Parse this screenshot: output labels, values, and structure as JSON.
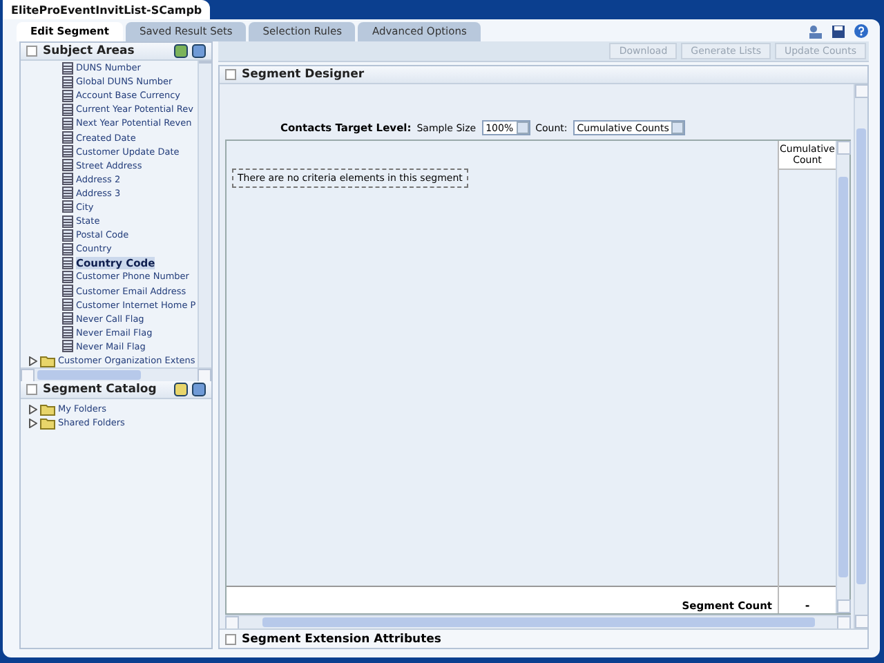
{
  "window": {
    "title": "EliteProEventInvitList-SCampb"
  },
  "tabs": [
    {
      "label": "Edit Segment",
      "selected": true
    },
    {
      "label": "Saved Result Sets",
      "selected": false
    },
    {
      "label": "Selection Rules",
      "selected": false
    },
    {
      "label": "Advanced Options",
      "selected": false
    }
  ],
  "subject_areas": {
    "title": "Subject Areas",
    "items": [
      {
        "label": "DUNS Number",
        "kind": "column",
        "selected": false
      },
      {
        "label": "Global DUNS Number",
        "kind": "column",
        "selected": false
      },
      {
        "label": "Account Base Currency",
        "kind": "column",
        "selected": false
      },
      {
        "label": "Current Year Potential Rev",
        "kind": "column",
        "selected": false
      },
      {
        "label": "Next Year Potential Reven",
        "kind": "column",
        "selected": false
      },
      {
        "label": "Created Date",
        "kind": "column",
        "selected": false
      },
      {
        "label": "Customer Update Date",
        "kind": "column",
        "selected": false
      },
      {
        "label": "Street Address",
        "kind": "column",
        "selected": false
      },
      {
        "label": "Address 2",
        "kind": "column",
        "selected": false
      },
      {
        "label": "Address 3",
        "kind": "column",
        "selected": false
      },
      {
        "label": "City",
        "kind": "column",
        "selected": false
      },
      {
        "label": "State",
        "kind": "column",
        "selected": false
      },
      {
        "label": "Postal Code",
        "kind": "column",
        "selected": false
      },
      {
        "label": "Country",
        "kind": "column",
        "selected": false
      },
      {
        "label": "Country Code",
        "kind": "column",
        "selected": true
      },
      {
        "label": "Customer Phone Number",
        "kind": "column",
        "selected": false
      },
      {
        "label": "Customer Email Address",
        "kind": "column",
        "selected": false
      },
      {
        "label": "Customer Internet Home P",
        "kind": "column",
        "selected": false
      },
      {
        "label": "Never Call Flag",
        "kind": "column",
        "selected": false
      },
      {
        "label": "Never Email Flag",
        "kind": "column",
        "selected": false
      },
      {
        "label": "Never Mail Flag",
        "kind": "column",
        "selected": false
      },
      {
        "label": "Customer Organization Extens",
        "kind": "folder",
        "selected": false
      }
    ]
  },
  "segment_catalog": {
    "title": "Segment Catalog",
    "items": [
      {
        "label": "My Folders"
      },
      {
        "label": "Shared Folders"
      }
    ]
  },
  "toolbar": {
    "buttons": [
      {
        "label": "Download",
        "disabled": true
      },
      {
        "label": "Generate Lists",
        "disabled": true
      },
      {
        "label": "Update Counts",
        "disabled": true
      }
    ]
  },
  "designer": {
    "title": "Segment Designer",
    "target_level": "Contacts Target Level:",
    "sample_size_label": "Sample Size",
    "sample_size": "100%",
    "count_label": "Count:",
    "count": "Cumulative Counts",
    "empty_message": "There are no criteria elements in this segment",
    "column_header": "Cumulative Count",
    "segment_count_label": "Segment Count",
    "segment_count": "-"
  },
  "extension": {
    "title": "Segment Extension Attributes"
  }
}
